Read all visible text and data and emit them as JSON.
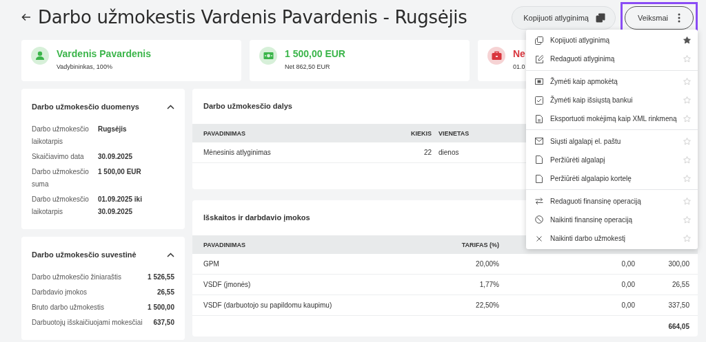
{
  "page": {
    "title": "Darbo užmokestis Vardenis Pavardenis - Rugsėjis"
  },
  "header_buttons": [
    {
      "kind": "copy",
      "label": "Kopijuoti atlyginimą",
      "highlighted": false
    },
    {
      "kind": "menu",
      "label": "Veiksmai",
      "highlighted": true
    }
  ],
  "summary_cards": [
    {
      "kind": "person",
      "color": "#3bb54a",
      "title": "Vardenis Pavardenis",
      "subtitle": "Vadybininkas, 100%"
    },
    {
      "kind": "money",
      "color": "#3bb54a",
      "title": "1 500,00 EUR",
      "subtitle": "Net 862,50 EUR"
    },
    {
      "kind": "briefcase",
      "color": "#d9363e",
      "title": "Ne",
      "subtitle": "01.0"
    }
  ],
  "details_panel": {
    "title": "Darbo užmokesčio duomenys",
    "expanded": true,
    "rows": [
      {
        "label": "Darbo užmokesčio laikotarpis",
        "value": "Rugsėjis"
      },
      {
        "label": "Skaičiavimo data",
        "value": "30.09.2025"
      },
      {
        "label": "Darbo užmokesčio suma",
        "value": "1 500,00 EUR"
      },
      {
        "label": "Darbo užmokesčio laikotarpis",
        "value": "01.09.2025 iki 30.09.2025"
      }
    ]
  },
  "summary_panel": {
    "title": "Darbo užmokesčio suvestinė",
    "expanded": true,
    "rows": [
      {
        "label": "Darbo užmokesčio žiniaraštis",
        "value": "1 526,55"
      },
      {
        "label": "Darbdavio įmokos",
        "value": "26,55"
      },
      {
        "label": "Bruto darbo užmokestis",
        "value": "1 500,00"
      },
      {
        "label": "Darbuotojų išskaičiuojami mokesčiai",
        "value": "637,50"
      }
    ]
  },
  "parts_table": {
    "title": "Darbo užmokesčio dalys",
    "columns": [
      "PAVADINIMAS",
      "KIEKIS",
      "VIENETAS"
    ],
    "rows": [
      {
        "name": "Mėnesinis atlyginimas",
        "quantity": "22",
        "unit": "dienos"
      }
    ]
  },
  "deductions_table": {
    "title": "Išskaitos ir darbdavio įmokos",
    "columns": [
      "PAVADINIMAS",
      "TARIFAS (%)"
    ],
    "rows": [
      {
        "name": "GPM",
        "rate": "20,00%",
        "column_3": "0,00",
        "column_4": "300,00"
      },
      {
        "name": "VSDF (įmonės)",
        "rate": "1,77%",
        "column_3": "0,00",
        "column_4": "26,55"
      },
      {
        "name": "VSDF (darbuotojo su papildomu kaupimu)",
        "rate": "22,50%",
        "column_3": "0,00",
        "column_4": "337,50"
      }
    ],
    "total": {
      "column_4": "664,05"
    }
  },
  "actions_menu": {
    "groups": [
      [
        {
          "kind": "copy",
          "label": "Kopijuoti atlyginimą",
          "starred": true
        },
        {
          "kind": "edit",
          "label": "Redaguoti atlyginimą",
          "starred": false
        }
      ],
      [
        {
          "kind": "money",
          "label": "Žymėti kaip apmokėtą",
          "starred": false
        },
        {
          "kind": "check",
          "label": "Žymėti kaip išsiųstą bankui",
          "starred": false
        },
        {
          "kind": "file-code",
          "label": "Eksportuoti mokėjimą kaip XML rinkmeną",
          "starred": false
        }
      ],
      [
        {
          "kind": "mail",
          "label": "Siųsti algalapį el. paštu",
          "starred": false
        },
        {
          "kind": "file",
          "label": "Peržiūrėti algalapį",
          "starred": false
        },
        {
          "kind": "file",
          "label": "Peržiūrėti algalapio kortelę",
          "starred": false
        }
      ],
      [
        {
          "kind": "swap",
          "label": "Redaguoti finansinę operaciją",
          "starred": false
        },
        {
          "kind": "ban",
          "label": "Naikinti finansinę operaciją",
          "starred": false
        },
        {
          "kind": "close",
          "label": "Naikinti darbo užmokestį",
          "starred": false
        }
      ]
    ]
  }
}
